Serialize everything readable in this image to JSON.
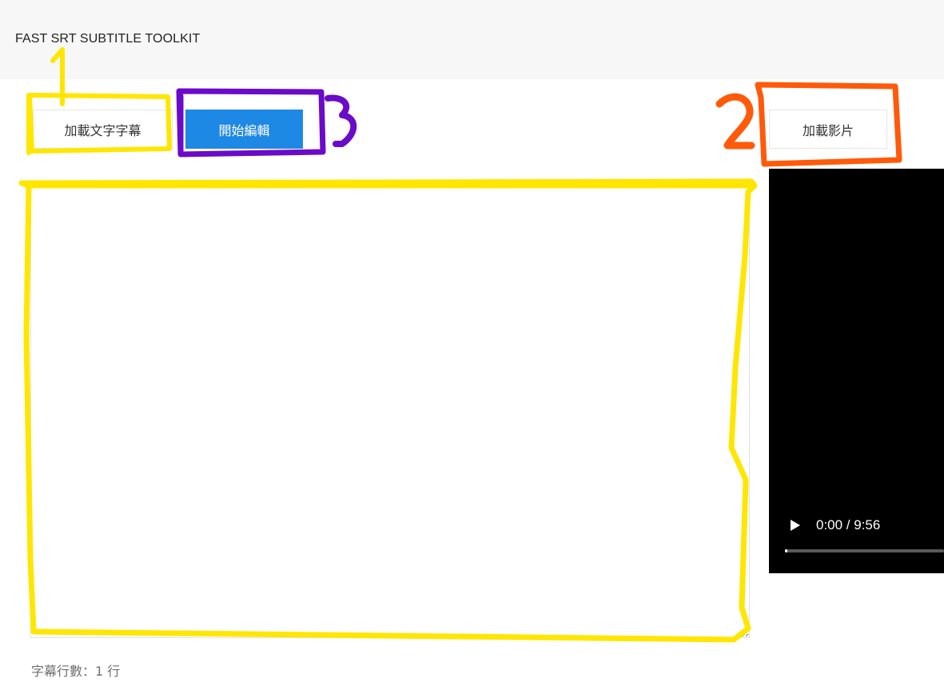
{
  "app": {
    "title": "FAST SRT SUBTITLE TOOLKIT"
  },
  "toolbar": {
    "load_subtitle_label": "加載文字字幕",
    "start_edit_label": "開始編輯",
    "load_video_label": "加載影片"
  },
  "editor": {
    "value": ""
  },
  "video": {
    "time": "0:00 / 9:56",
    "progress_fraction": 0.0
  },
  "status": {
    "line_count": "字幕行數：1 行"
  },
  "annotations": {
    "labels": [
      "1",
      "2",
      "3"
    ],
    "colors": {
      "yellow": "#FFE600",
      "orange": "#FF5A0A",
      "purple": "#6B0AC9"
    }
  },
  "icons": {
    "play": "play-icon",
    "resize": "resize-grip-icon"
  }
}
